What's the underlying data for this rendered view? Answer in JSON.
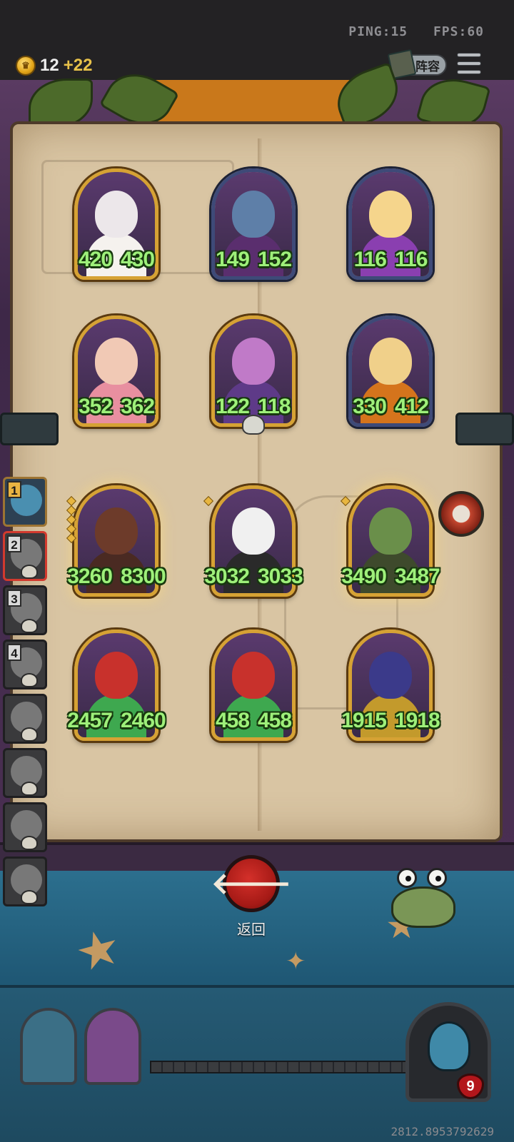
{
  "status_bar": {
    "ping": "PING:15",
    "fps": "FPS:60"
  },
  "gold": {
    "count": "12",
    "income": "+22",
    "icon": "crown-coin-icon"
  },
  "header": {
    "lineup_label": "阵容",
    "lineup_icon": "lineup-book-icon",
    "menu_icon": "hamburger-menu-icon"
  },
  "board": {
    "rows": [
      [
        {
          "name": "unit-white-flower-girl",
          "frame": "gold",
          "attack": "420",
          "health": "430",
          "colors": [
            "#ece7ea",
            "#f5f2ee"
          ]
        },
        {
          "name": "unit-blue-sorceress",
          "frame": "silver",
          "attack": "149",
          "health": "152",
          "colors": [
            "#5e7fa8",
            "#5a2e6e"
          ]
        },
        {
          "name": "unit-blonde-elf",
          "frame": "silver",
          "attack": "116",
          "health": "116",
          "colors": [
            "#f5d58c",
            "#8a3fb0"
          ]
        }
      ],
      [
        {
          "name": "unit-pink-flower-fairy",
          "frame": "gold",
          "attack": "352",
          "health": "362",
          "colors": [
            "#f1c9b5",
            "#e88fa0"
          ]
        },
        {
          "name": "unit-purple-thorn-witch",
          "frame": "gold",
          "attack": "122",
          "health": "118",
          "colors": [
            "#c07ac8",
            "#5e3a88"
          ],
          "skull": true
        },
        {
          "name": "unit-orange-pumpkin-girl",
          "frame": "silver",
          "attack": "330",
          "health": "412",
          "colors": [
            "#f0d08a",
            "#d5741c"
          ]
        }
      ],
      [
        {
          "name": "unit-boar-beast",
          "frame": "gold",
          "attack": "3260",
          "health": "8300",
          "colors": [
            "#6d3b2a",
            "#4a2a22"
          ],
          "pips": 5,
          "glow": true
        },
        {
          "name": "unit-cow-monster",
          "frame": "gold",
          "attack": "3032",
          "health": "3033",
          "colors": [
            "#f0f0f0",
            "#2a2a2a"
          ],
          "pips": 1
        },
        {
          "name": "unit-green-vulture",
          "frame": "gold",
          "attack": "3490",
          "health": "3487",
          "colors": [
            "#6a8f4a",
            "#3e4a2c"
          ],
          "pips": 1,
          "glow": true
        }
      ],
      [
        {
          "name": "unit-apple-frog-1",
          "frame": "gold",
          "attack": "2457",
          "health": "2460",
          "colors": [
            "#c8312c",
            "#3ea84f"
          ]
        },
        {
          "name": "unit-apple-frog-2",
          "frame": "gold",
          "attack": "458",
          "health": "458",
          "colors": [
            "#c8312c",
            "#3ea84f"
          ]
        },
        {
          "name": "unit-golden-hammer",
          "frame": "gold",
          "attack": "1915",
          "health": "1918",
          "colors": [
            "#3b3a8a",
            "#c39a2c"
          ]
        }
      ]
    ]
  },
  "sidebar": {
    "players": [
      {
        "rank": "1",
        "state": "first"
      },
      {
        "rank": "2",
        "state": "active"
      },
      {
        "rank": "3",
        "state": "dead"
      },
      {
        "rank": "4",
        "state": "dead"
      },
      {
        "rank": "",
        "state": "dead"
      },
      {
        "rank": "",
        "state": "dead"
      },
      {
        "rank": "",
        "state": "dead"
      },
      {
        "rank": "",
        "state": "dead"
      }
    ]
  },
  "back": {
    "label": "返回",
    "icon": "arrow-left-icon"
  },
  "hero": {
    "health": "9",
    "icon": "blue-bat-hero-icon"
  },
  "debug_value": "2812.8953792629",
  "colors": {
    "stat_text": "#9ef07a",
    "gold_frame": "#d6a234",
    "silver_frame": "#3e4a78",
    "back_button": "#c02520"
  }
}
